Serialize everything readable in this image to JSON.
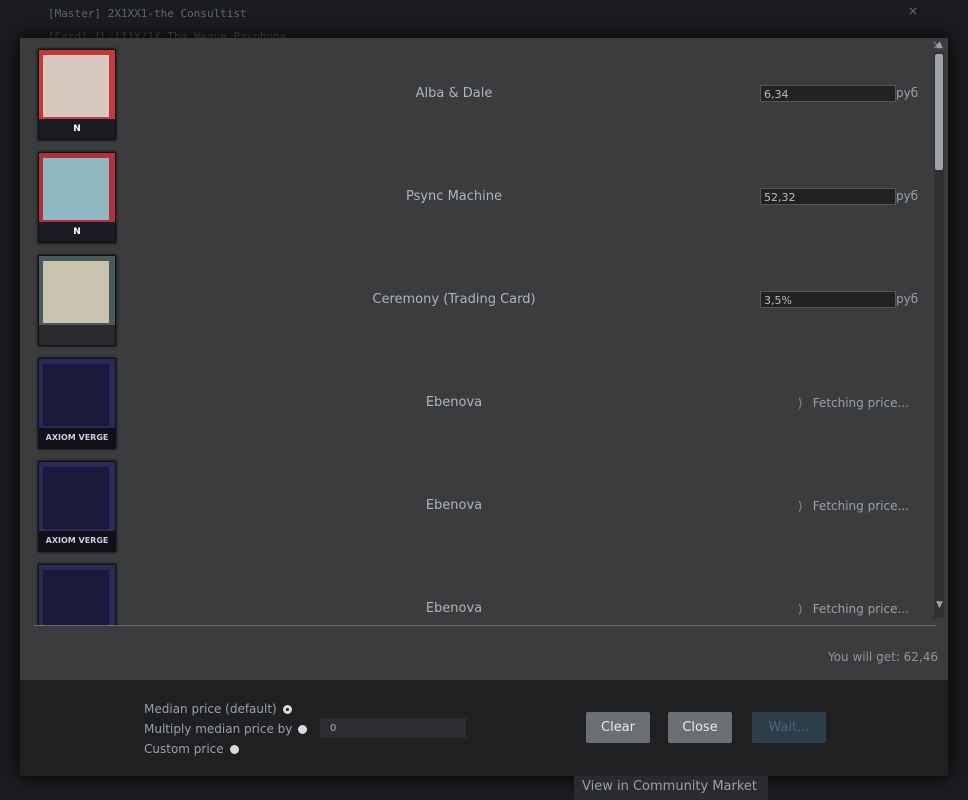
{
  "background": {
    "line1": "[Master] 2X1XX1-the Consultist",
    "line2": "[Card] [L-[1]X/1X The Weave Payphone",
    "close": "×"
  },
  "dialog": {
    "close": "×",
    "items": [
      {
        "name": "Alba & Dale",
        "price": "6,34",
        "currency": "руб",
        "status": "price",
        "card_color": "#c23a3a",
        "footer": "N"
      },
      {
        "name": "Psync Machine",
        "price": "52,32",
        "currency": "руб",
        "status": "price",
        "card_color": "#b03040",
        "footer": "N"
      },
      {
        "name": "Ceremony (Trading Card)",
        "price": "3,5%",
        "currency": "руб",
        "status": "price",
        "card_color": "#4a5a5a",
        "footer": ""
      },
      {
        "name": "Ebenova",
        "fetching": "Fetching price...",
        "status": "fetching",
        "card_color": "#2a2a5a",
        "footer": "AXIOM VERGE"
      },
      {
        "name": "Ebenova",
        "fetching": "Fetching price...",
        "status": "fetching",
        "card_color": "#2a2a5a",
        "footer": "AXIOM VERGE"
      },
      {
        "name": "Ebenova",
        "fetching": "Fetching price...",
        "status": "fetching",
        "card_color": "#2a2a5a",
        "footer": ""
      }
    ],
    "spinner": "⟩",
    "total": "You will get: 62,46",
    "options": {
      "median": "Median price (default)",
      "multiply": "Multiply median price by",
      "multiply_value": "0",
      "custom": "Custom price"
    },
    "buttons": {
      "clear": "Clear",
      "close": "Close",
      "wait": "Wait..."
    }
  },
  "market_link": "View in Community Market"
}
